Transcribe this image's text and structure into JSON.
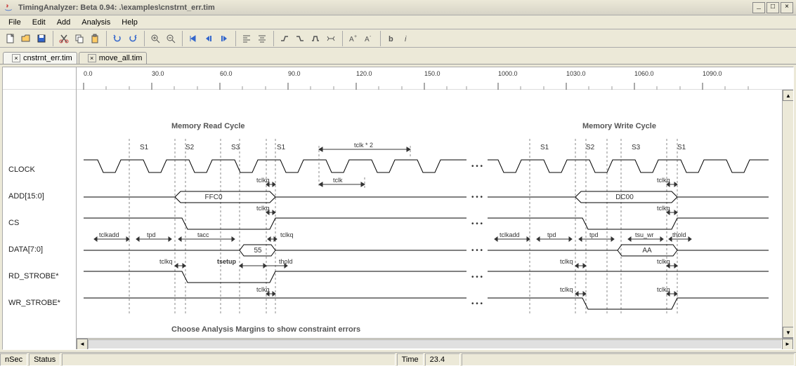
{
  "title": "TimingAnalyzer: Beta 0.94:  .\\examples\\cnstrnt_err.tim",
  "menu": [
    "File",
    "Edit",
    "Add",
    "Analysis",
    "Help"
  ],
  "tabs": [
    {
      "label": "cnstrnt_err.tim",
      "active": true
    },
    {
      "label": "move_all.tim",
      "active": false
    }
  ],
  "ruler_left": [
    "0.0",
    "30.0",
    "60.0",
    "90.0",
    "120.0",
    "150.0"
  ],
  "ruler_right": [
    "1000.0",
    "1030.0",
    "1060.0",
    "1090.0"
  ],
  "signals": [
    "CLOCK",
    "ADD[15:0]",
    "CS",
    "DATA[7:0]",
    "RD_STROBE*",
    "WR_STROBE*"
  ],
  "section_titles": {
    "read": "Memory Read Cycle",
    "write": "Memory Write Cycle"
  },
  "state_labels": [
    "S1",
    "S2",
    "S3",
    "S1"
  ],
  "bus_values": {
    "add_read": "FFC0",
    "add_write": "DC00",
    "data_read": "55",
    "data_write": "AA"
  },
  "timing_labels": {
    "tclkq": "tclkq",
    "tclk": "tclk",
    "tclk2": "tclk * 2",
    "tclkadd": "tclkadd",
    "tpd": "tpd",
    "tacc": "tacc",
    "tsetup": "tsetup",
    "thold": "thold",
    "tsu_wr": "tsu_wr"
  },
  "footer_msg": "Choose Analysis Margins to show constraint errors",
  "status": {
    "unit": "nSec",
    "status_label": "Status",
    "time_label": "Time",
    "time_value": "23.4"
  },
  "dots": "• • •",
  "chart_data": {
    "type": "timing-diagram",
    "time_unit": "nSec",
    "visible_ranges": [
      [
        0,
        170
      ],
      [
        990,
        1100
      ]
    ],
    "clock_period": 30,
    "signals": [
      {
        "name": "CLOCK",
        "type": "clock",
        "period": 30
      },
      {
        "name": "ADD[15:0]",
        "type": "bus",
        "segments": [
          {
            "range": "read",
            "value": "FFC0"
          },
          {
            "range": "write",
            "value": "DC00"
          }
        ]
      },
      {
        "name": "CS",
        "type": "signal",
        "active_low": true
      },
      {
        "name": "DATA[7:0]",
        "type": "bus",
        "segments": [
          {
            "range": "read",
            "value": "55"
          },
          {
            "range": "write",
            "value": "AA"
          }
        ]
      },
      {
        "name": "RD_STROBE*",
        "type": "signal",
        "active_low": true
      },
      {
        "name": "WR_STROBE*",
        "type": "signal",
        "active_low": true
      }
    ],
    "constraints": [
      "tclkq",
      "tclk",
      "tclk*2",
      "tclkadd",
      "tpd",
      "tacc",
      "tsetup",
      "thold",
      "tsu_wr"
    ]
  }
}
